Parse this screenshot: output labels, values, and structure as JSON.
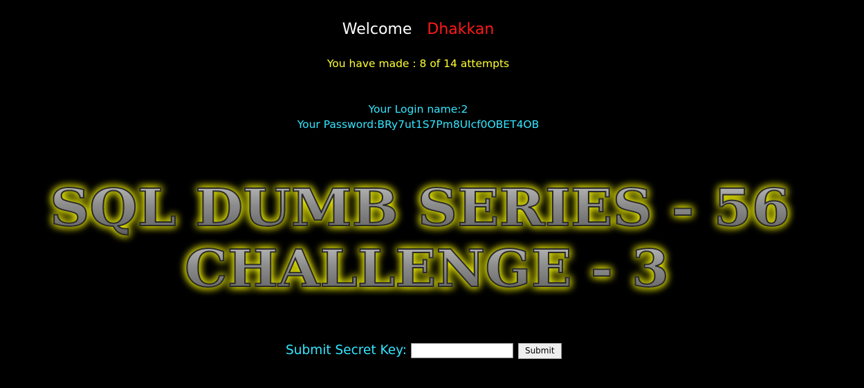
{
  "header": {
    "welcome_label": "Welcome",
    "user_name": "Dhakkan",
    "attempts_text": "You have made : 8 of 14 attempts"
  },
  "credentials": {
    "login_text": "Your Login name:2",
    "password_text": "Your Password:BRy7ut1S7Pm8UIcf0OBET4OB"
  },
  "banner": {
    "line1": "SQL DUMB SERIES - 56",
    "line2": "CHALLENGE - 3"
  },
  "form": {
    "label": "Submit Secret Key:",
    "input_value": "",
    "submit_label": "Submit"
  },
  "colors": {
    "background": "#000000",
    "welcome_text": "#ffffff",
    "user_name": "#ff1a1a",
    "attempts_text": "#ffff33",
    "credentials_text": "#33e6ff",
    "banner_glow": "#e6e600",
    "banner_fill": "#8c8c8c"
  }
}
